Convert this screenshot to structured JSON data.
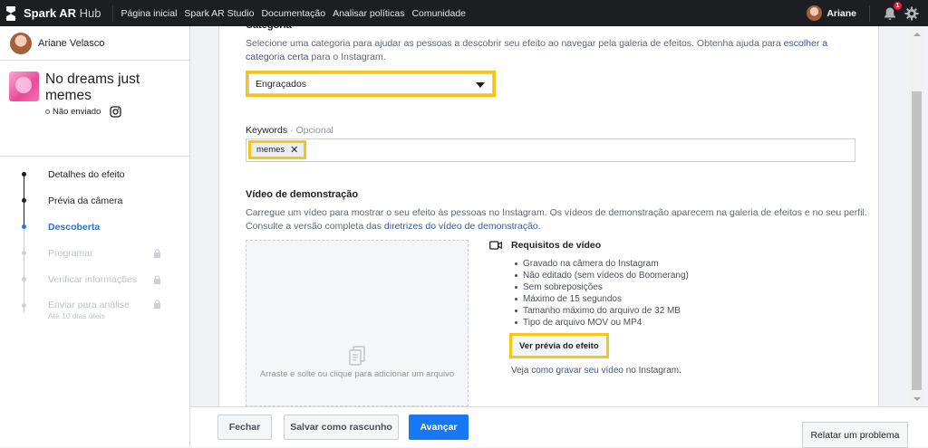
{
  "topbar": {
    "brand_bold": "Spark AR",
    "brand_light": "Hub",
    "nav": [
      "Página inicial",
      "Spark AR Studio",
      "Documentação",
      "Analisar políticas",
      "Comunidade"
    ],
    "user_name": "Ariane",
    "notification_count": "1"
  },
  "sidebar": {
    "user_name": "Ariane Velasco",
    "effect_name": "No dreams just memes",
    "effect_status": "Não enviado",
    "steps": [
      {
        "label": "Detalhes do efeito",
        "state": "done"
      },
      {
        "label": "Prévia da câmera",
        "state": "done"
      },
      {
        "label": "Descoberta",
        "state": "active"
      },
      {
        "label": "Programar",
        "state": "locked"
      },
      {
        "label": "Verificar informações",
        "state": "locked"
      },
      {
        "label": "Enviar para análise",
        "sub": "Até 10 dias úteis",
        "state": "locked"
      }
    ]
  },
  "main": {
    "category_title": "Categoria",
    "category_desc": "Selecione uma categoria para ajudar as pessoas a descobrir seu efeito ao navegar pela galeria de efeitos. Obtenha ajuda para",
    "category_link": "escolher a categoria certa",
    "category_desc_end": "para o Instagram.",
    "category_value": "Engraçados",
    "keywords_label": "Keywords",
    "keywords_optional": "· Opcional",
    "keyword_chip": "memes",
    "video_title": "Vídeo de demonstração",
    "video_desc": "Carregue um vídeo para mostrar o seu efeito às pessoas no Instagram. Os vídeos de demonstração aparecem na galeria de efeitos e no seu perfil. Consulte a versão completa das",
    "video_link": "diretrizes do vídeo de demonstração",
    "video_desc_end": ".",
    "upload_text": "Arraste e solte ou clique para adicionar um arquivo",
    "requirements_title": "Requisitos de vídeo",
    "requirements": [
      "Gravado na câmera do Instagram",
      "Não editado (sem vídeos do Boomerang)",
      "Sem sobreposições",
      "Máximo de 15 segundos",
      "Tamanho máximo do arquivo de 32 MB",
      "Tipo de arquivo MOV ou MP4"
    ],
    "preview_button": "Ver prévia do efeito",
    "see_prefix": "Veja",
    "see_link": "como gravar seu vídeo",
    "see_suffix": "no Instagram."
  },
  "footer": {
    "close": "Fechar",
    "save_draft": "Salvar como rascunho",
    "next": "Avançar",
    "report": "Relatar um problema"
  },
  "colors": {
    "highlight": "#f5c518",
    "primary": "#1877f2",
    "link": "#385898",
    "topbar": "#1c1e21"
  }
}
